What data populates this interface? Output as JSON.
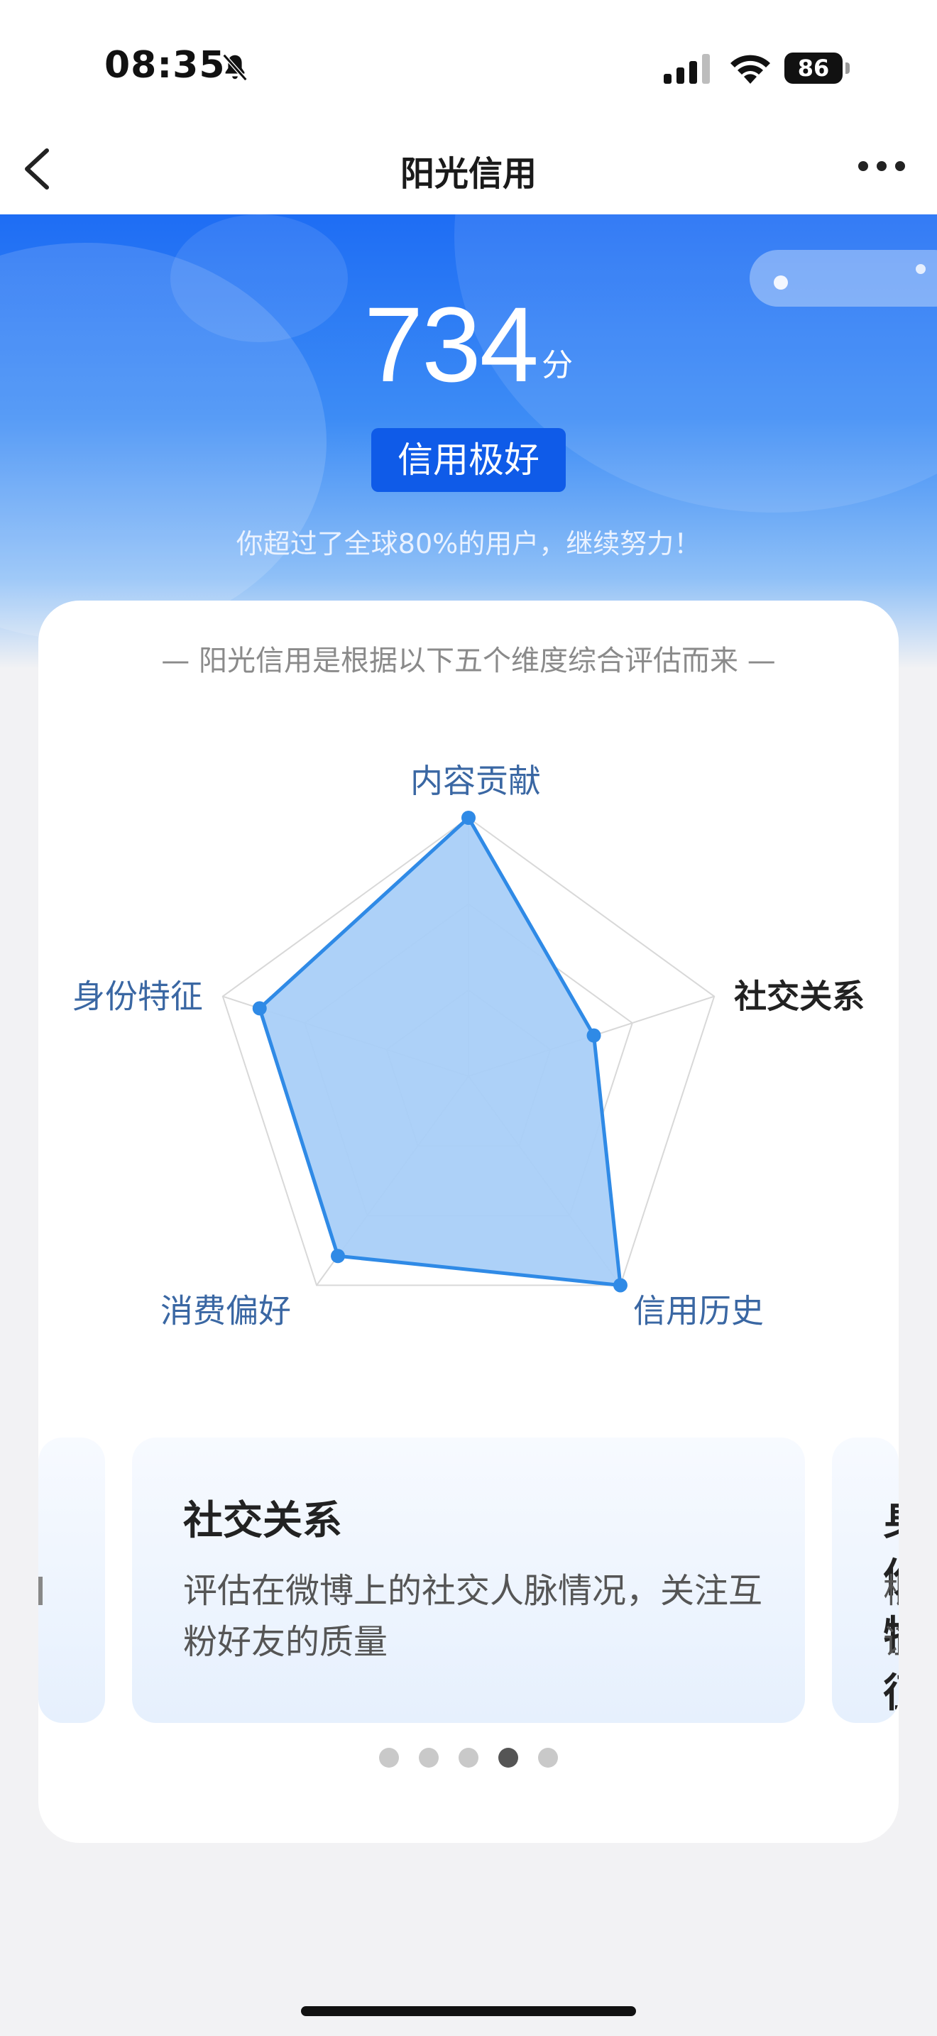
{
  "status_bar": {
    "time": "08:35",
    "battery": "86"
  },
  "nav": {
    "title": "阳光信用"
  },
  "score": {
    "value": "734",
    "unit": "分",
    "level": "信用极好",
    "beat_text": "你超过了全球80%的用户，继续努力！"
  },
  "card": {
    "subtitle": "— 阳光信用是根据以下五个维度综合评估而来 —"
  },
  "radar": {
    "axes": [
      {
        "label": "内容贡献",
        "value": 1.0,
        "active": false
      },
      {
        "label": "社交关系",
        "value": 0.51,
        "active": true
      },
      {
        "label": "信用历史",
        "value": 1.0,
        "active": false
      },
      {
        "label": "消费偏好",
        "value": 0.86,
        "active": false
      },
      {
        "label": "身份特征",
        "value": 0.85,
        "active": false
      }
    ],
    "colors": {
      "fill": "#a9cff8",
      "stroke": "#2f8ae6",
      "grid": "#d8d8d8"
    }
  },
  "carousel": {
    "slides": [
      {
        "title": "社交关系",
        "desc": "评估在微博上的社交人脉情况，关注互粉好友的质量"
      },
      {
        "title": "身份特征",
        "desc_line1": "根",
        "desc_line2": "证"
      }
    ],
    "active_index": 3,
    "dot_count": 5
  },
  "icons": [
    "bell-off-icon",
    "signal-icon",
    "wifi-icon",
    "battery-icon",
    "back-arrow-icon",
    "more-icon"
  ]
}
